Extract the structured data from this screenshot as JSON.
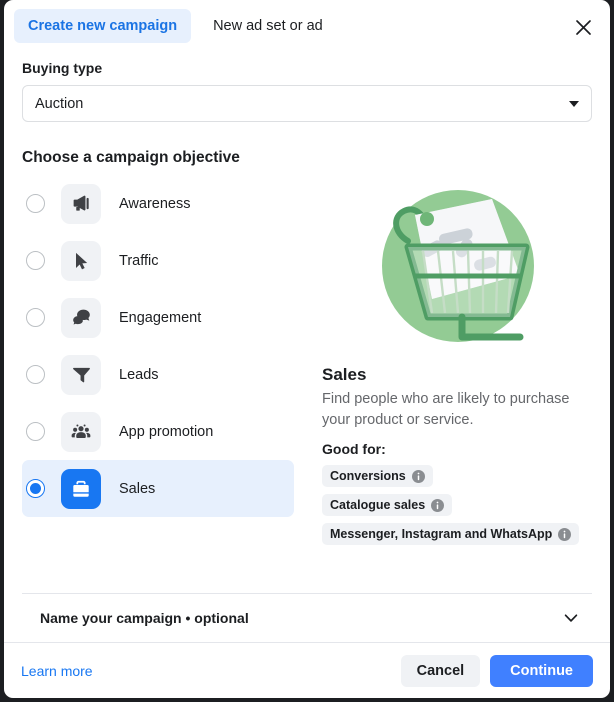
{
  "header": {
    "tabs": [
      {
        "label": "Create new campaign",
        "active": true,
        "name": "tab-create-new-campaign"
      },
      {
        "label": "New ad set or ad",
        "active": false,
        "name": "tab-new-ad-set-or-ad"
      }
    ],
    "close_icon": "close-icon"
  },
  "buying_type": {
    "label": "Buying type",
    "value": "Auction",
    "caret_icon": "chevron-down-icon"
  },
  "objective": {
    "section_title": "Choose a campaign objective",
    "items": [
      {
        "label": "Awareness",
        "icon": "megaphone-icon",
        "selected": false
      },
      {
        "label": "Traffic",
        "icon": "cursor-arrow-icon",
        "selected": false
      },
      {
        "label": "Engagement",
        "icon": "chat-bubbles-icon",
        "selected": false
      },
      {
        "label": "Leads",
        "icon": "funnel-icon",
        "selected": false
      },
      {
        "label": "App promotion",
        "icon": "people-group-icon",
        "selected": false
      },
      {
        "label": "Sales",
        "icon": "briefcase-icon",
        "selected": true
      }
    ]
  },
  "preview": {
    "illustration": "shopping-basket-with-price-tag-illustration",
    "title": "Sales",
    "description": "Find people who are likely to purchase your product or service.",
    "good_for_label": "Good for:",
    "badges": [
      {
        "label": "Conversions",
        "info_icon": "info-icon"
      },
      {
        "label": "Catalogue sales",
        "info_icon": "info-icon"
      },
      {
        "label": "Messenger, Instagram and WhatsApp",
        "info_icon": "info-icon"
      }
    ]
  },
  "name_section": {
    "label": "Name your campaign • optional",
    "chevron_icon": "chevron-down-icon"
  },
  "footer": {
    "learn_more": "Learn more",
    "cancel": "Cancel",
    "continue": "Continue"
  },
  "colors": {
    "accent_blue": "#1877f2",
    "primary_button": "#4080ff",
    "selected_row_bg": "#e7f0fd",
    "tile_bg": "#f0f2f5",
    "illustration_green": "#93cb94",
    "illustration_green_dark": "#4f9d64",
    "text_primary": "#1c1e21",
    "text_secondary": "#65676b"
  }
}
